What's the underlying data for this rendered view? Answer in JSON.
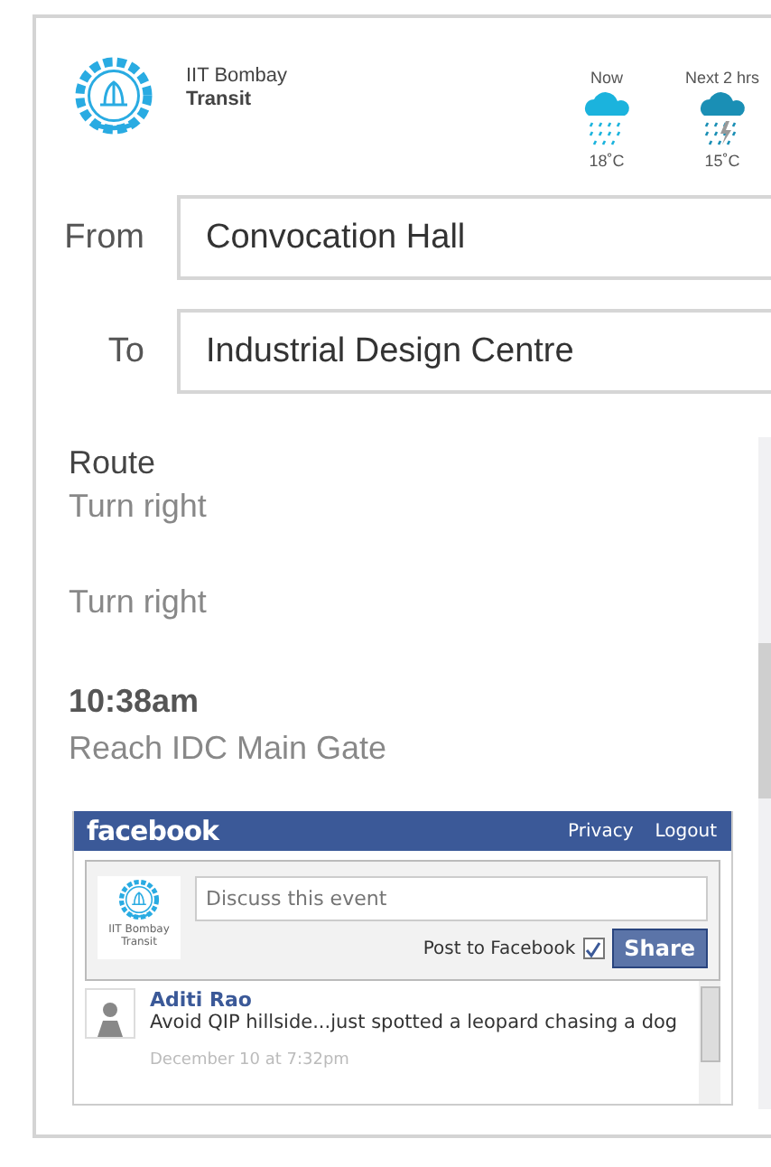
{
  "header": {
    "org": "IIT Bombay",
    "app": "Transit"
  },
  "weather": [
    {
      "label": "Now",
      "temp": "18˚C",
      "kind": "rain"
    },
    {
      "label": "Next 2 hrs",
      "temp": "15˚C",
      "kind": "storm"
    }
  ],
  "form": [
    {
      "label": "From",
      "value": "Convocation Hall"
    },
    {
      "label": "To",
      "value": "Industrial Design Centre"
    }
  ],
  "route": {
    "title": "Route",
    "steps": [
      {
        "kind": "step",
        "text": "Turn right"
      },
      {
        "kind": "step",
        "text": "Turn right"
      },
      {
        "kind": "time",
        "text": "10:38am"
      },
      {
        "kind": "step",
        "text": "Reach IDC Main Gate"
      }
    ]
  },
  "facebook": {
    "brand": "facebook",
    "links": [
      "Privacy",
      "Logout"
    ],
    "logo_caption": [
      "IIT Bombay",
      "Transit"
    ],
    "placeholder": "Discuss this event",
    "post_label": "Post to Facebook",
    "post_checked": true,
    "share": "Share",
    "comments": [
      {
        "author": "Aditi Rao",
        "text": "Avoid QIP hillside...just spotted a leopard chasing a dog",
        "date": "December 10 at 7:32pm"
      }
    ]
  }
}
